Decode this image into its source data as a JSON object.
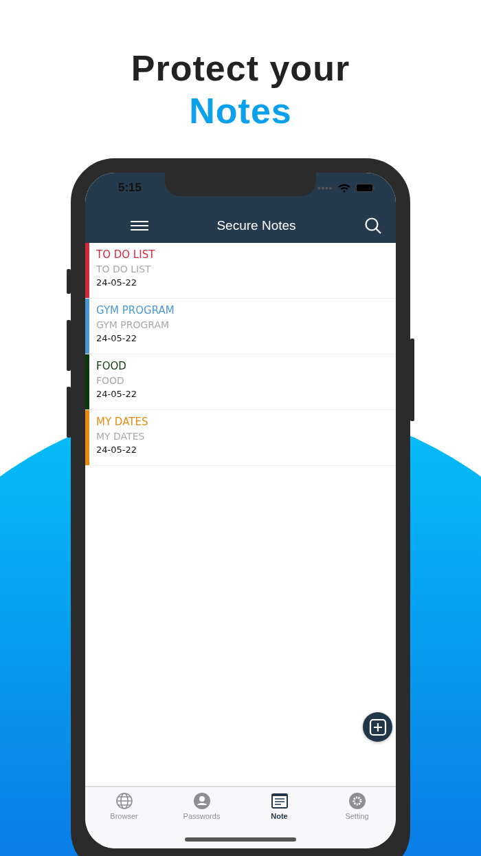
{
  "headline": {
    "line1": "Protect your",
    "line2": "Notes"
  },
  "status_bar": {
    "time": "5:15"
  },
  "header": {
    "title": "Secure Notes"
  },
  "notes": [
    {
      "title": "TO DO LIST",
      "preview": "TO DO LIST",
      "date": "24-05-22",
      "color": "#d0293a"
    },
    {
      "title": "GYM PROGRAM",
      "preview": "GYM PROGRAM",
      "date": "24-05-22",
      "color": "#4b97d6"
    },
    {
      "title": "FOOD",
      "preview": "FOOD",
      "date": "24-05-22",
      "color": "#0c3a0c"
    },
    {
      "title": "MY DATES",
      "preview": "MY DATES",
      "date": "24-05-22",
      "color": "#e98b0f"
    }
  ],
  "tabs": [
    {
      "label": "Browser",
      "kind": "globe",
      "selected": false
    },
    {
      "label": "Passwords",
      "kind": "person",
      "selected": false
    },
    {
      "label": "Note",
      "kind": "note",
      "selected": true
    },
    {
      "label": "Setting",
      "kind": "gear",
      "selected": false
    }
  ]
}
